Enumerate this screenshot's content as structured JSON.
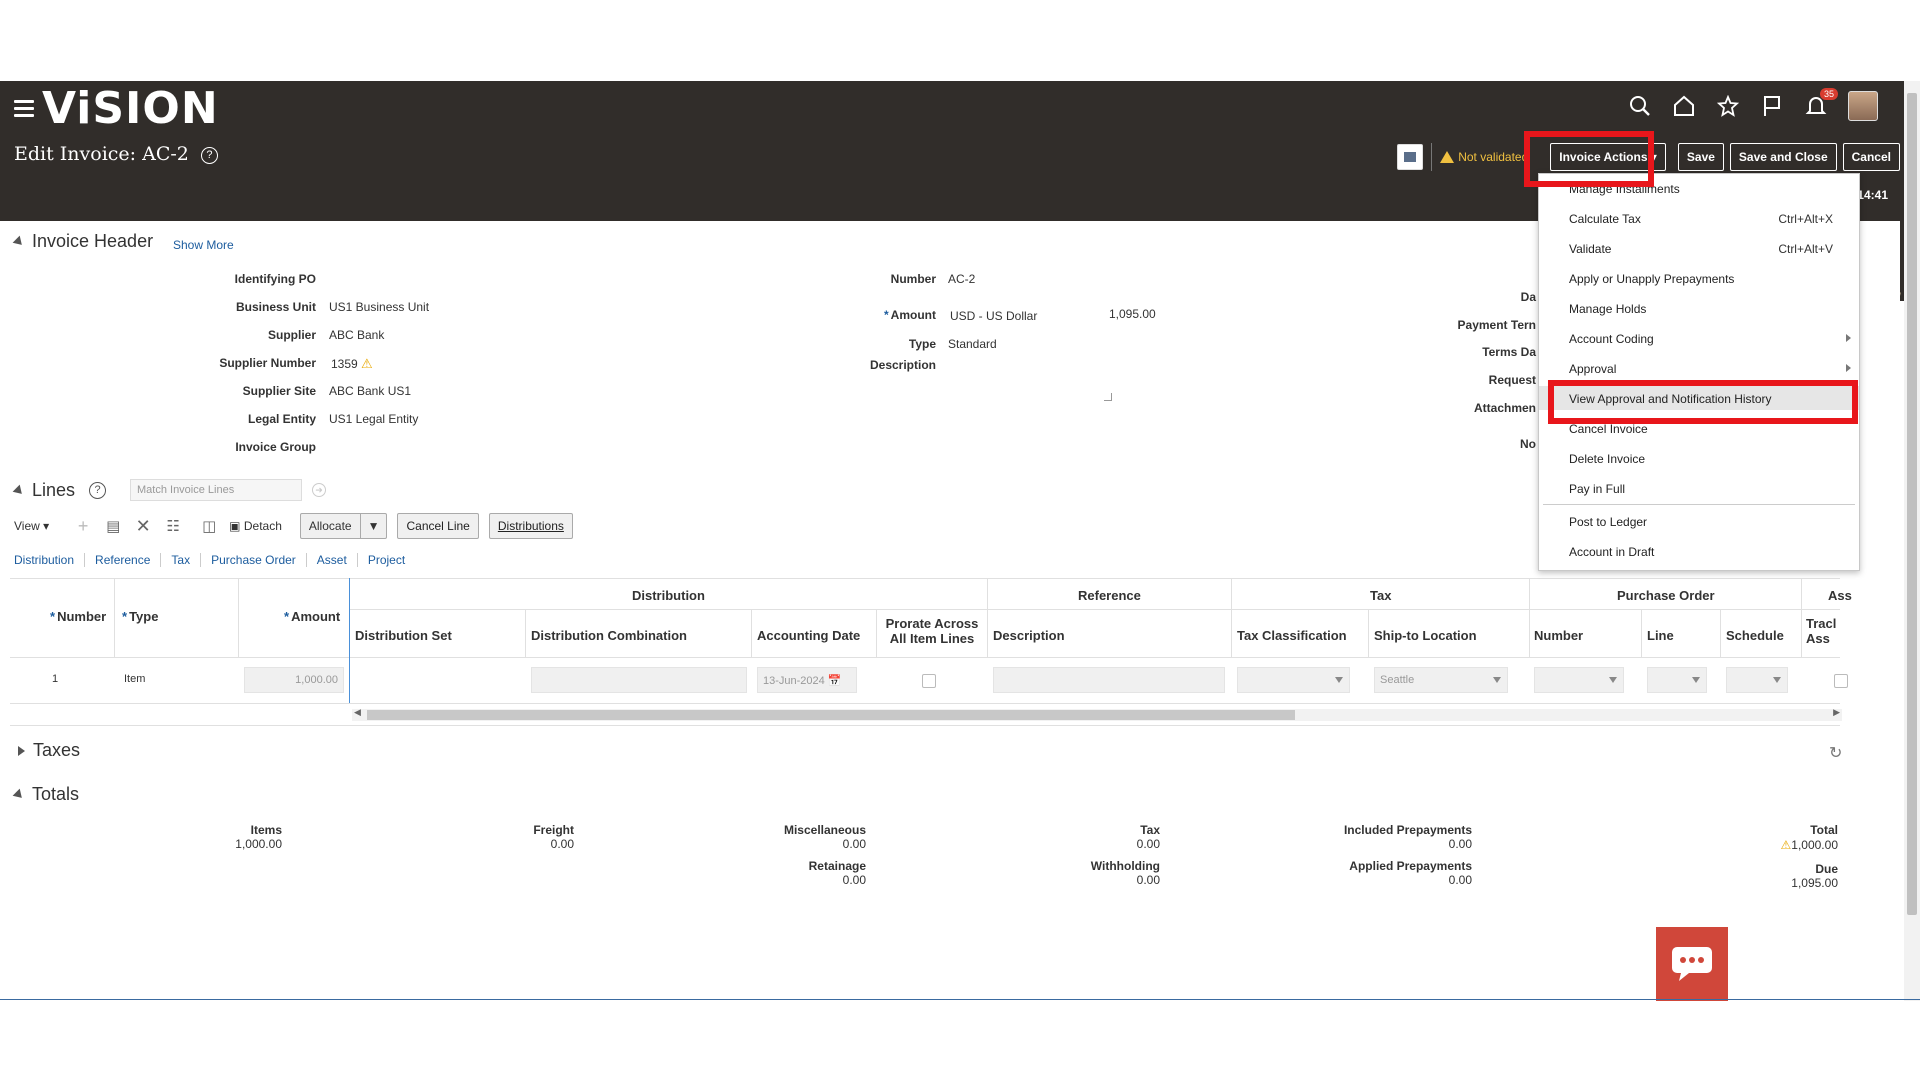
{
  "header": {
    "logo": "ViSION",
    "page_title": "Edit Invoice: AC-2",
    "help": "?",
    "notifications_count": "35",
    "status_text": "Not validated",
    "invoice_actions_label": "Invoice Actions",
    "save_label": "Save",
    "save_close_label": "Save and Close",
    "cancel_label": "Cancel",
    "time_clip": "14:41",
    "icons": [
      "search-icon",
      "home-icon",
      "star-icon",
      "flag-icon",
      "bell-icon"
    ]
  },
  "invoice_header": {
    "title": "Invoice Header",
    "show_more": "Show More",
    "left_fields": [
      {
        "label": "Identifying PO",
        "value": ""
      },
      {
        "label": "Business Unit",
        "value": "US1 Business Unit"
      },
      {
        "label": "Supplier",
        "value": "ABC Bank"
      },
      {
        "label": "Supplier Number",
        "value": "1359"
      },
      {
        "label": "Supplier Site",
        "value": "ABC Bank US1"
      },
      {
        "label": "Legal Entity",
        "value": "US1 Legal Entity"
      },
      {
        "label": "Invoice Group",
        "value": ""
      }
    ],
    "number_label": "Number",
    "number_value": "AC-2",
    "amount_label": "Amount",
    "amount_currency": "USD - US Dollar",
    "amount_value": "1,095.00",
    "type_label": "Type",
    "type_value": "Standard",
    "description_label": "Description",
    "right_labels_clipped": [
      "Da",
      "Payment Tern",
      "Terms Da",
      "Request",
      "Attachmen",
      "No"
    ]
  },
  "lines": {
    "title": "Lines",
    "match_placeholder": "Match Invoice Lines",
    "view_label": "View",
    "detach_label": "Detach",
    "allocate_label": "Allocate",
    "cancel_line_label": "Cancel Line",
    "distributions_label": "Distributions",
    "tabs": [
      "Distribution",
      "Reference",
      "Tax",
      "Purchase Order",
      "Asset",
      "Project"
    ],
    "group_headers": {
      "distribution": "Distribution",
      "reference": "Reference",
      "tax": "Tax",
      "purchase_order": "Purchase Order",
      "asset": "Ass"
    },
    "columns": {
      "number": "Number",
      "type": "Type",
      "amount": "Amount",
      "distribution_set": "Distribution Set",
      "distribution_combination": "Distribution Combination",
      "accounting_date": "Accounting Date",
      "prorate": "Prorate Across All Item Lines",
      "description": "Description",
      "tax_classification": "Tax Classification",
      "ship_to": "Ship-to Location",
      "po_number": "Number",
      "po_line": "Line",
      "schedule": "Schedule",
      "track_asset": "Tracl Ass"
    },
    "row": {
      "number": "1",
      "type": "Item",
      "amount": "1,000.00",
      "accounting_date": "13-Jun-2024",
      "ship_to": "Seattle"
    }
  },
  "taxes": {
    "title": "Taxes"
  },
  "totals": {
    "title": "Totals",
    "items_label": "Items",
    "items_value": "1,000.00",
    "freight_label": "Freight",
    "freight_value": "0.00",
    "misc_label": "Miscellaneous",
    "misc_value": "0.00",
    "retainage_label": "Retainage",
    "retainage_value": "0.00",
    "tax_label": "Tax",
    "tax_value": "0.00",
    "withholding_label": "Withholding",
    "withholding_value": "0.00",
    "included_prepay_label": "Included Prepayments",
    "included_prepay_value": "0.00",
    "applied_prepay_label": "Applied Prepayments",
    "applied_prepay_value": "0.00",
    "total_label": "Total",
    "total_value": "1,000.00",
    "due_label": "Due",
    "due_value": "1,095.00"
  },
  "menu": {
    "items": [
      {
        "label": "Manage Installments",
        "shortcut": ""
      },
      {
        "label": "Calculate Tax",
        "shortcut": "Ctrl+Alt+X"
      },
      {
        "label": "Validate",
        "shortcut": "Ctrl+Alt+V"
      },
      {
        "label": "Apply or Unapply Prepayments",
        "shortcut": ""
      },
      {
        "label": "Manage Holds",
        "shortcut": ""
      },
      {
        "label": "Account Coding",
        "shortcut": ""
      },
      {
        "label": "Approval",
        "shortcut": ""
      },
      {
        "label": "View Approval and Notification History",
        "shortcut": ""
      },
      {
        "label": "Cancel Invoice",
        "shortcut": ""
      },
      {
        "label": "Delete Invoice",
        "shortcut": ""
      },
      {
        "label": "Pay in Full",
        "shortcut": ""
      },
      {
        "label": "Post to Ledger",
        "shortcut": ""
      },
      {
        "label": "Account in Draft",
        "shortcut": ""
      }
    ]
  },
  "colors": {
    "header_bg": "#312d2a",
    "link": "#1c5c9e",
    "highlight_box": "#e8161b",
    "warning": "#f0c040",
    "chat_button": "#d0473a"
  }
}
